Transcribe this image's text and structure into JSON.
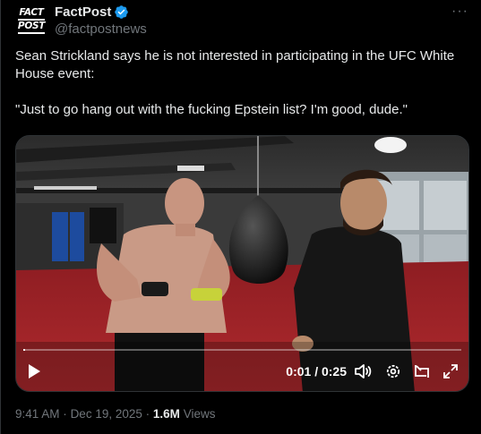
{
  "account": {
    "display_name": "FactPost",
    "handle": "@factpostnews",
    "avatar_line1": "FACT",
    "avatar_line2": "POST",
    "verified": true
  },
  "tweet": {
    "paragraph1": "Sean Strickland says he is not interested in participating in the UFC White House event:",
    "paragraph2": "\"Just to go hang out with the fucking Epstein list? I'm good, dude.\""
  },
  "video": {
    "current_time": "0:01",
    "duration": "0:25",
    "time_display": "0:01 / 0:25",
    "progress_fraction": 0.004,
    "icons": [
      "play-icon",
      "volume-icon",
      "settings-icon",
      "pop-out-icon",
      "fullscreen-icon"
    ]
  },
  "meta": {
    "time": "9:41 AM",
    "separator": "·",
    "date": "Dec 19, 2025",
    "views_count": "1.6M",
    "views_label": "Views"
  },
  "colors": {
    "background": "#000000",
    "text_primary": "#e7e9ea",
    "text_secondary": "#71767b",
    "verified_blue": "#1d9bf0",
    "gym_mat_red": "#a8262a"
  }
}
